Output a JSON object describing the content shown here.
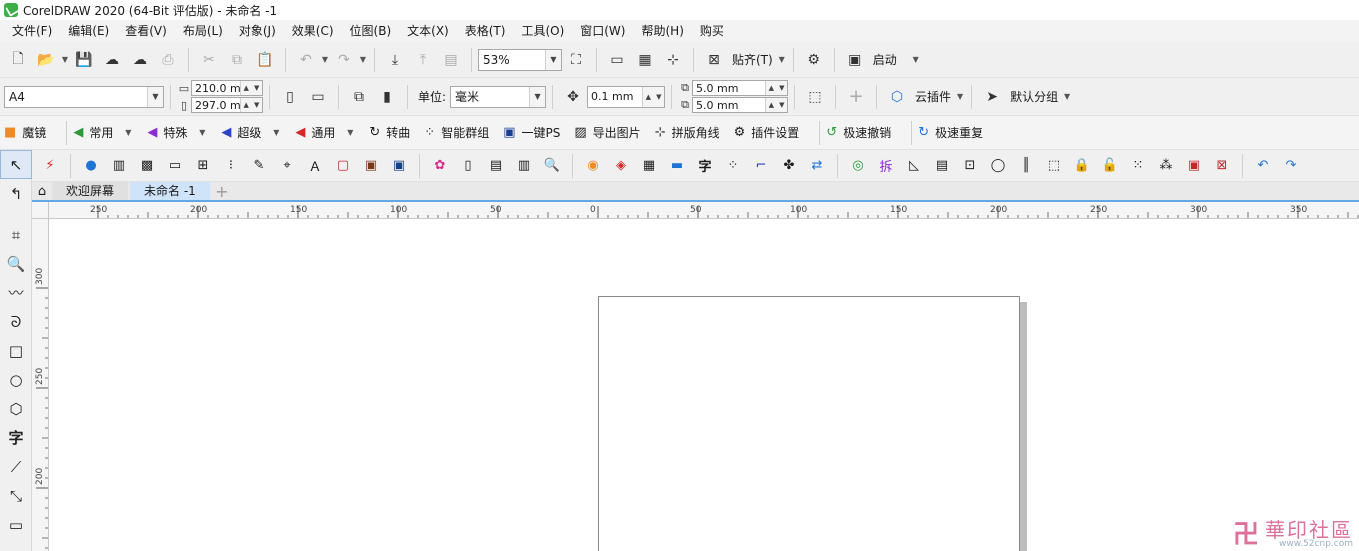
{
  "window": {
    "title": "CorelDRAW 2020 (64-Bit 评估版) - 未命名 -1"
  },
  "menu": [
    "文件(F)",
    "编辑(E)",
    "查看(V)",
    "布局(L)",
    "对象(J)",
    "效果(C)",
    "位图(B)",
    "文本(X)",
    "表格(T)",
    "工具(O)",
    "窗口(W)",
    "帮助(H)",
    "购买"
  ],
  "standard_toolbar": {
    "zoom": "53%",
    "snap_label": "贴齐(T)",
    "launch_label": "启动"
  },
  "property_bar": {
    "page_size": "A4",
    "width": "210.0 mm",
    "height": "297.0 mm",
    "units_label": "单位:",
    "units_value": "毫米",
    "nudge": "0.1 mm",
    "dup_x": "5.0 mm",
    "dup_y": "5.0 mm",
    "cloud_plugin": "云插件",
    "default_group": "默认分组"
  },
  "plugin_bar": [
    {
      "icon": "magic-mirror-icon",
      "label": "魔镜"
    },
    {
      "icon": "common-icon",
      "label": "常用"
    },
    {
      "icon": "special-icon",
      "label": "特殊"
    },
    {
      "icon": "super-icon",
      "label": "超级"
    },
    {
      "icon": "general-icon",
      "label": "通用"
    },
    {
      "icon": "convert-curve-icon",
      "label": "转曲"
    },
    {
      "icon": "smart-group-icon",
      "label": "智能群组"
    },
    {
      "icon": "photoshop-icon",
      "label": "一键PS"
    },
    {
      "icon": "export-image-icon",
      "label": "导出图片"
    },
    {
      "icon": "crop-mark-icon",
      "label": "拼版角线"
    },
    {
      "icon": "plugin-settings-icon",
      "label": "插件设置"
    },
    {
      "icon": "fast-undo-icon",
      "label": "极速撤销"
    },
    {
      "icon": "fast-redo-icon",
      "label": "极速重复"
    }
  ],
  "doc_tabs": [
    "欢迎屏幕",
    "未命名 -1"
  ],
  "ruler": {
    "h_labels": [
      "250",
      "200",
      "150",
      "100",
      "50",
      "0",
      "50",
      "100",
      "150",
      "200",
      "250",
      "300",
      "350"
    ],
    "v_labels": [
      "300",
      "250",
      "200"
    ]
  },
  "watermark": {
    "cn": "華印社區",
    "url": "www.52cnp.com"
  },
  "colors": {
    "accent_tab": "#62a7e6",
    "plugin_orange": "#f08a24"
  }
}
